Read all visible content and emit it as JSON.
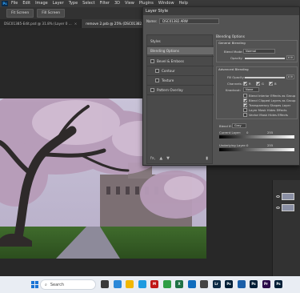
{
  "menu": [
    "File",
    "Edit",
    "Image",
    "Layer",
    "Type",
    "Select",
    "Filter",
    "3D",
    "View",
    "Plugins",
    "Window",
    "Help"
  ],
  "app_logo": "Ps",
  "options_bar": {
    "fit_screen": "Fit Screen",
    "fill_screen": "Fill Screen"
  },
  "tabs": [
    {
      "label": "DSC01385-Edit.psd @ 31.8% (Layer 0 ...",
      "close": "×"
    },
    {
      "label": "remove 2.psb @ 25% (DSC01382.A...",
      "close": "×"
    }
  ],
  "dialog": {
    "title": "Layer Style",
    "name_label": "Name:",
    "name_value": "DSC01382.ARW",
    "styles_header": "Styles",
    "items": [
      {
        "label": "Blending Options",
        "selected": true,
        "checkbox": false
      },
      {
        "label": "Bevel & Emboss",
        "selected": false,
        "checkbox": true
      },
      {
        "label": "Contour",
        "selected": false,
        "checkbox": true
      },
      {
        "label": "Texture",
        "selected": false,
        "checkbox": true
      },
      {
        "label": "Pattern Overlay",
        "selected": false,
        "checkbox": true
      }
    ],
    "footer_icons": [
      "fx",
      "up-icon",
      "down-icon",
      "trash-icon"
    ],
    "footer_fx": "fx,",
    "blending": {
      "title": "Blending Options",
      "general": "General Blending",
      "blend_mode_label": "Blend Mode:",
      "blend_mode_value": "Normal",
      "opacity_label": "Opacity:",
      "opacity_value": "100",
      "advanced": "Advanced Blending",
      "fill_opacity_label": "Fill Opacity:",
      "fill_opacity_value": "100",
      "channels_label": "Channels:",
      "channels": [
        "R",
        "G",
        "B"
      ],
      "knockout_label": "Knockout:",
      "knockout_value": "None",
      "checkboxes": [
        {
          "label": "Blend Interior Effects as Group",
          "checked": false
        },
        {
          "label": "Blend Clipped Layers as Group",
          "checked": true
        },
        {
          "label": "Transparency Shapes Layer",
          "checked": true
        },
        {
          "label": "Layer Mask Hides Effects",
          "checked": false
        },
        {
          "label": "Vector Mask Hides Effects",
          "checked": false
        }
      ],
      "blend_if_label": "Blend If:",
      "blend_if_value": "Gray",
      "current_layer": "Current Layer:",
      "current_min": "0",
      "current_max": "255",
      "underlying_layer": "Underlying Layer:",
      "underlying_min": "0",
      "underlying_max": "255"
    }
  },
  "taskbar": {
    "search_placeholder": "Search",
    "apps": [
      {
        "name": "task-view-icon",
        "color": "#3a3a3a",
        "glyph": ""
      },
      {
        "name": "widgets-icon",
        "color": "#2b88d8",
        "glyph": ""
      },
      {
        "name": "file-explorer-icon",
        "color": "#f2b701",
        "glyph": ""
      },
      {
        "name": "edge-icon",
        "color": "#1f9be0",
        "glyph": ""
      },
      {
        "name": "mcafee-icon",
        "color": "#c01818",
        "glyph": "M"
      },
      {
        "name": "chrome-icon",
        "color": "#2f9e44",
        "glyph": ""
      },
      {
        "name": "excel-icon",
        "color": "#1e7145",
        "glyph": "X"
      },
      {
        "name": "store-icon",
        "color": "#0f6cbd",
        "glyph": ""
      },
      {
        "name": "app-icon",
        "color": "#444",
        "glyph": ""
      },
      {
        "name": "lightroom-classic-icon",
        "color": "#0d2b45",
        "glyph": "Lr"
      },
      {
        "name": "photoshop-icon",
        "color": "#001e36",
        "glyph": "Ps"
      },
      {
        "name": "camera-raw-icon",
        "color": "#1b5fa8",
        "glyph": ""
      },
      {
        "name": "photoshop-beta-icon",
        "color": "#001e36",
        "glyph": "Ps"
      },
      {
        "name": "premiere-icon",
        "color": "#2a0a48",
        "glyph": "Pr"
      },
      {
        "name": "photoshop-2-icon",
        "color": "#001e36",
        "glyph": "Ps"
      }
    ]
  },
  "colors": {
    "accent": "#31a8ff",
    "dialog_bg": "#535353",
    "selected_item": "#6a6a6a"
  }
}
